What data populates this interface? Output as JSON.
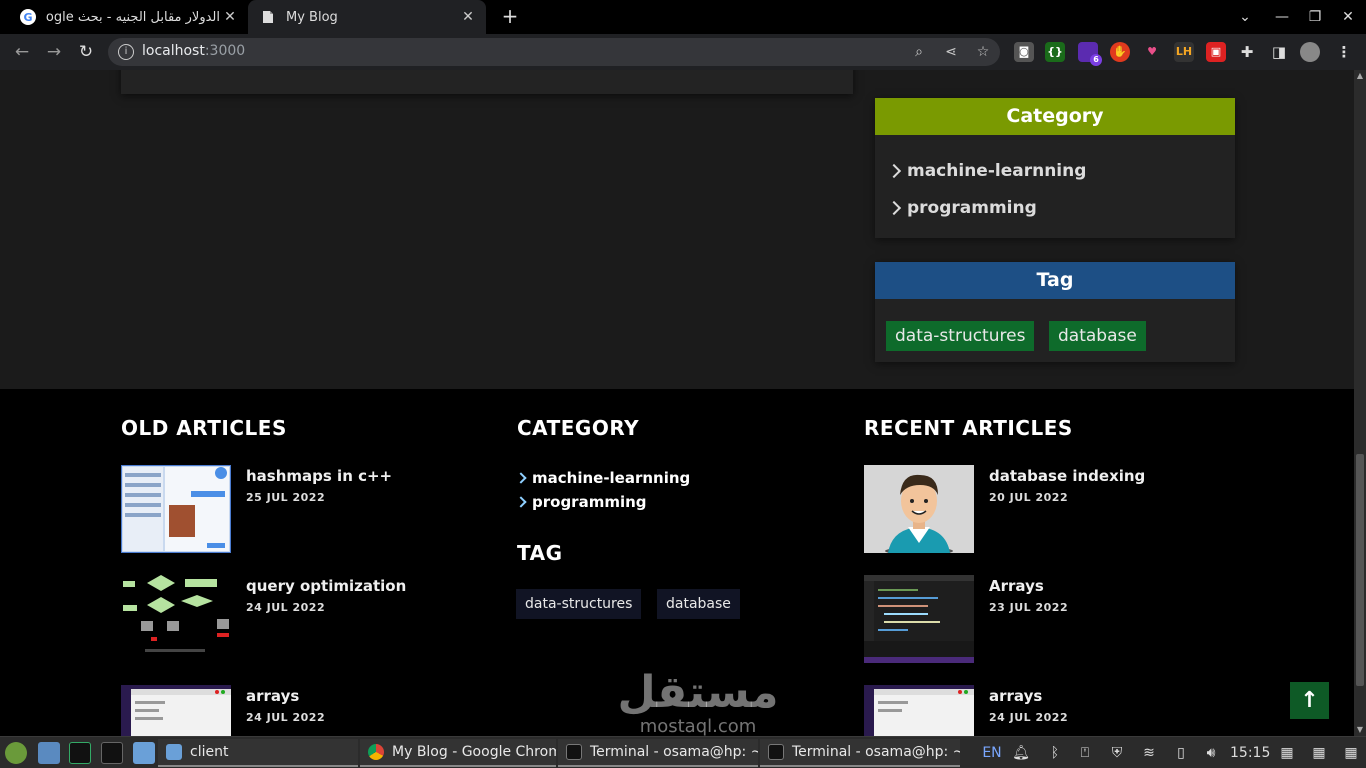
{
  "browser": {
    "tabs": [
      {
        "title": "الدولار مقابل الجنيه - بحث Google",
        "favicon": "G"
      },
      {
        "title": "My Blog",
        "favicon": "doc"
      }
    ],
    "new_tab_label": "+",
    "window_controls": {
      "chevron": "⌄",
      "minimize": "—",
      "restore": "❐",
      "close": "✕"
    },
    "url_host": "localhost",
    "url_port": ":3000",
    "extension_badge": "6"
  },
  "sidebar": {
    "category": {
      "title": "Category",
      "items": [
        "machine-learnning",
        "programming"
      ],
      "color": "#7a9a01"
    },
    "tag": {
      "title": "Tag",
      "items": [
        "data-structures",
        "database"
      ],
      "color": "#1d4f85",
      "pill_color": "#0e6b2b"
    }
  },
  "footer": {
    "old_articles": {
      "title": "OLD ARTICLES",
      "items": [
        {
          "title": "hashmaps in c++",
          "date": "25 JUL 2022"
        },
        {
          "title": "query optimization",
          "date": "24 JUL 2022"
        },
        {
          "title": "arrays",
          "date": "24 JUL 2022"
        }
      ]
    },
    "category": {
      "title": "CATEGORY",
      "items": [
        "machine-learnning",
        "programming"
      ]
    },
    "tag": {
      "title": "TAG",
      "items": [
        "data-structures",
        "database"
      ]
    },
    "recent_articles": {
      "title": "RECENT ARTICLES",
      "items": [
        {
          "title": "database indexing",
          "date": "20 JUL 2022"
        },
        {
          "title": "Arrays",
          "date": "23 JUL 2022"
        },
        {
          "title": "arrays",
          "date": "24 JUL 2022"
        }
      ]
    },
    "back_to_top": "↑"
  },
  "watermark": {
    "arabic": "مستقل",
    "latin": "mostaql.com"
  },
  "taskbar": {
    "windows": [
      {
        "label": "client"
      },
      {
        "label": "My Blog - Google Chrome"
      },
      {
        "label": "Terminal - osama@hp: ~/..."
      },
      {
        "label": "Terminal - osama@hp: ~/..."
      }
    ],
    "lang": "EN",
    "clock": "15:15"
  }
}
